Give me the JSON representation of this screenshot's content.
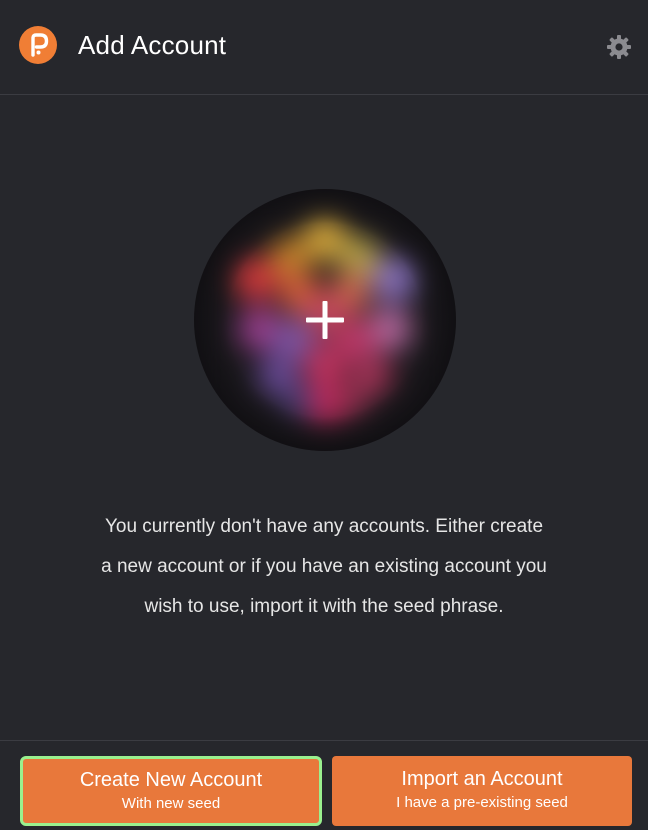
{
  "header": {
    "title": "Add Account",
    "logo_icon": "polkadot-logo-icon",
    "settings_icon": "gear-icon"
  },
  "avatar": {
    "icon": "plus-icon"
  },
  "message": {
    "line1": "You currently don't have any accounts. Either create",
    "line2": "a new account or if you have an existing account you",
    "line3": "wish to use, import it with the seed phrase."
  },
  "buttons": {
    "create": {
      "label": "Create New Account",
      "sublabel": "With new seed"
    },
    "import": {
      "label": "Import an Account",
      "sublabel": "I have a pre-existing seed"
    }
  },
  "colors": {
    "background": "#26272c",
    "accent": "#e8783b",
    "focus_ring": "#9af08e"
  }
}
